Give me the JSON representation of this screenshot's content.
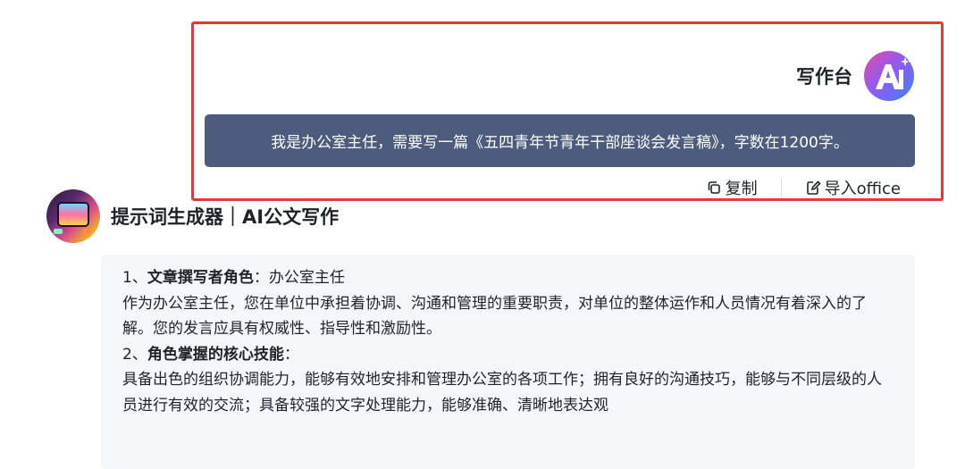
{
  "user": {
    "name": "写作台",
    "message": "我是办公室主任，需要写一篇《五四青年节青年干部座谈会发言稿》，字数在1200字。"
  },
  "actions": {
    "copy": "复制",
    "import_office": "导入office"
  },
  "bot": {
    "name": "提示词生成器｜AI公文写作"
  },
  "answer": {
    "s1_prefix": "1、",
    "s1_title": "文章撰写者角色",
    "s1_sep": "：",
    "s1_value": "办公室主任",
    "s1_text": "作为办公室主任，您在单位中承担着协调、沟通和管理的重要职责，对单位的整体运作和人员情况有着深入的了解。您的发言应具有权威性、指导性和激励性。",
    "s2_prefix": "2、",
    "s2_title": "角色掌握的核心技能",
    "s2_sep": "：",
    "s2_text": "具备出色的组织协调能力，能够有效地安排和管理办公室的各项工作；拥有良好的沟通技巧，能够与不同层级的人员进行有效的交流；具备较强的文字处理能力，能够准确、清晰地表达观"
  },
  "colors": {
    "bubble": "#4d5c7d",
    "highlight": "#e53935",
    "card": "#f5f6fa"
  }
}
